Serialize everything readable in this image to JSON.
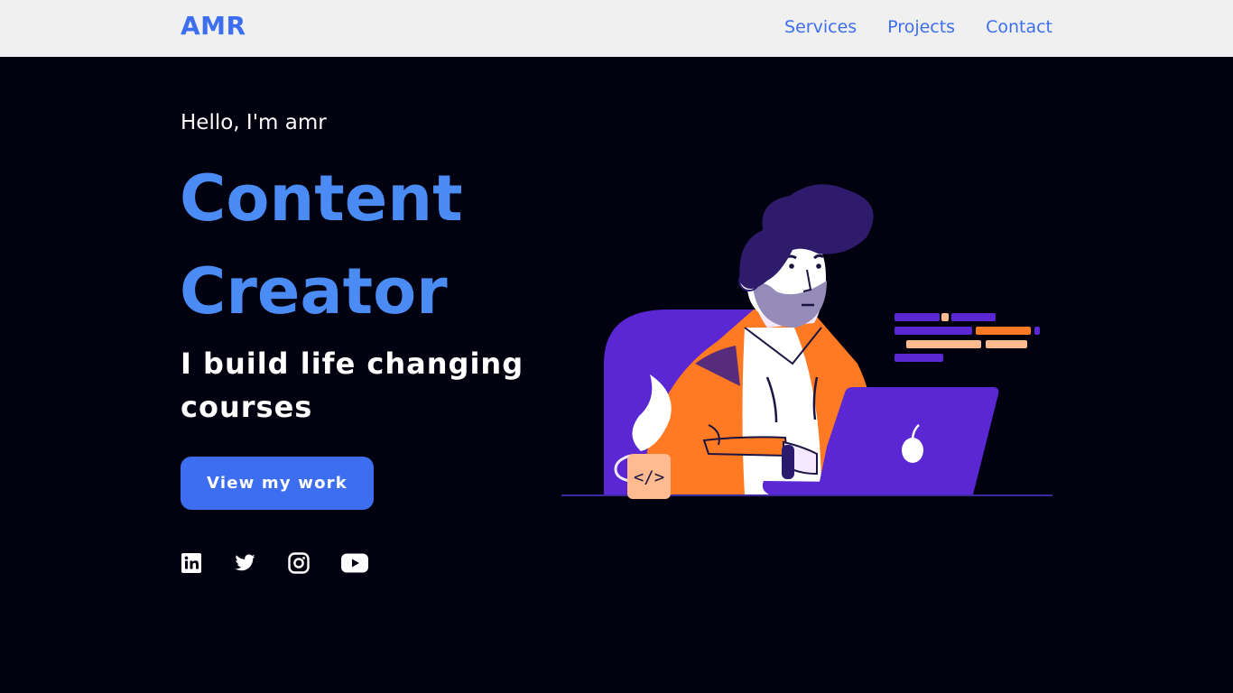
{
  "nav": {
    "logo": "AMR",
    "links": [
      {
        "label": "Services"
      },
      {
        "label": "Projects"
      },
      {
        "label": "Contact"
      }
    ]
  },
  "hero": {
    "greeting": "Hello, I'm amr",
    "title_line1": "Content",
    "title_line2": "Creator",
    "subtitle": "I build life changing courses",
    "cta_label": "View my work",
    "mug_label": "</>"
  },
  "socials": [
    {
      "icon": "linkedin-icon"
    },
    {
      "icon": "twitter-icon"
    },
    {
      "icon": "instagram-icon"
    },
    {
      "icon": "youtube-icon"
    }
  ],
  "colors": {
    "background": "#02010f",
    "navbar": "#f0f0f0",
    "accent": "#3d6ef0",
    "title": "#4a8cf4",
    "purple": "#5b27d3",
    "orange": "#ff7a22"
  }
}
